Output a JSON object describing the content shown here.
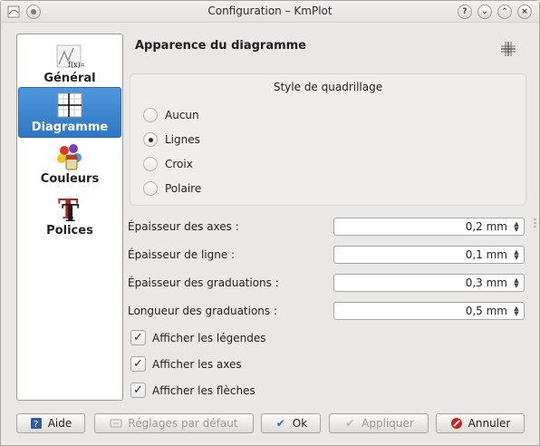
{
  "window": {
    "title": "Configuration – KmPlot"
  },
  "titlebar_buttons": {
    "help": "?",
    "minimize": "⌄",
    "maximize": "⌃",
    "close": "×"
  },
  "sidebar": {
    "items": [
      {
        "label": "Général",
        "icon": "function-graph-icon",
        "active": false
      },
      {
        "label": "Diagramme",
        "icon": "grid-axes-icon",
        "active": true
      },
      {
        "label": "Couleurs",
        "icon": "color-palette-icon",
        "active": false
      },
      {
        "label": "Polices",
        "icon": "font-icon",
        "active": false
      }
    ]
  },
  "main": {
    "title": "Apparence du diagramme",
    "grid_style": {
      "title": "Style de quadrillage",
      "options": [
        {
          "label": "Aucun",
          "selected": false
        },
        {
          "label": "Lignes",
          "selected": true
        },
        {
          "label": "Croix",
          "selected": false
        },
        {
          "label": "Polaire",
          "selected": false
        }
      ]
    },
    "fields": [
      {
        "label": "Épaisseur des axes  :",
        "value": "0,2 mm"
      },
      {
        "label": "Épaisseur de ligne  :",
        "value": "0,1 mm"
      },
      {
        "label": "Épaisseur des graduations  :",
        "value": "0,3 mm"
      },
      {
        "label": "Longueur des graduations  :",
        "value": "0,5 mm"
      }
    ],
    "checkboxes": [
      {
        "label": "Afficher les légendes",
        "checked": true
      },
      {
        "label": "Afficher les axes",
        "checked": true
      },
      {
        "label": "Afficher les flèches",
        "checked": true
      }
    ]
  },
  "buttons": {
    "help": "Aide",
    "defaults": "Réglages par défaut",
    "ok": "Ok",
    "apply": "Appliquer",
    "cancel": "Annuler"
  },
  "colors": {
    "accent": "#3b84cf",
    "cancel_icon": "#d0201a",
    "ok_icon": "#2c6db5"
  }
}
